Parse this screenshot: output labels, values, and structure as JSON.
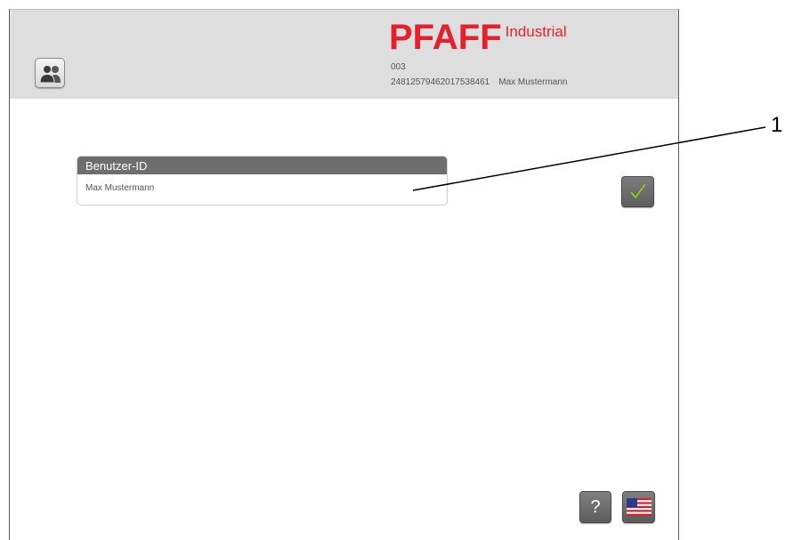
{
  "header": {
    "brand_name": "PFAFF",
    "brand_suffix": "Industrial",
    "station_number": "003",
    "serial_number": "24812579462017538461",
    "user_name": "Max Mustermann"
  },
  "form": {
    "field_label": "Benutzer-ID",
    "field_value": "Max Mustermann"
  },
  "footer": {
    "help_label": "?"
  },
  "annotation": {
    "callout_number": "1"
  },
  "icons": {
    "user_button": "users-icon",
    "confirm_button": "checkmark-icon",
    "language_button": "us-flag-icon"
  },
  "colors": {
    "brand": "#e3202c",
    "header_bg": "#dedede",
    "field_header_bg": "#6e6e6e",
    "check": "#8fd400",
    "button_bg": "#6e6e6e"
  }
}
